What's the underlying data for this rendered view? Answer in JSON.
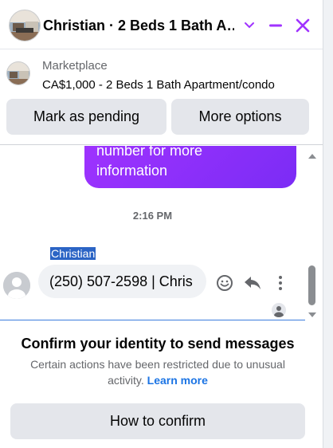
{
  "header": {
    "title": "Christian · 2 Beds 1 Bath A…",
    "icons": [
      "chevron-down-icon",
      "minimize-icon",
      "close-icon"
    ],
    "accent_color": "#a033ff"
  },
  "marketplace": {
    "label": "Marketplace",
    "listing_title": "CA$1,000 - 2 Beds 1 Bath Apartment/condo",
    "mark_pending_label": "Mark as pending",
    "more_options_label": "More options"
  },
  "thread": {
    "outgoing_tail_line1": "number for more",
    "outgoing_tail_line2": "information",
    "outgoing_color": "#8a2ff7",
    "timestamp": "2:16 PM",
    "sender_name": "Christian",
    "incoming_message": "(250) 507-2598 | Chris",
    "message_actions": [
      "emoji-icon",
      "reply-icon",
      "more-vertical-icon"
    ]
  },
  "confirm": {
    "title": "Confirm your identity to send messages",
    "text": "Certain actions have been restricted due to unusual activity.",
    "link": "Learn more",
    "button_label": "How to confirm",
    "link_color": "#1b74e4"
  }
}
